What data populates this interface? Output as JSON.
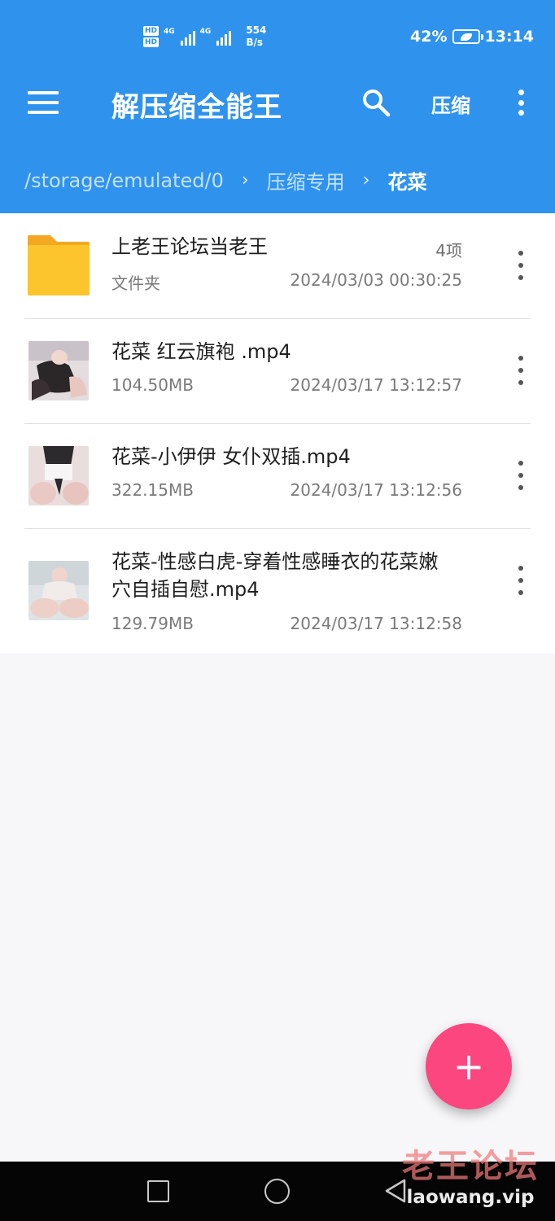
{
  "status_bar": {
    "hd1": "HD",
    "hd2": "HD",
    "net1": "4G",
    "net2": "4G",
    "speed_value": "554",
    "speed_unit": "B/s",
    "battery": "42%",
    "time": "13:14"
  },
  "app_bar": {
    "title": "解压缩全能王",
    "compress_label": "压缩"
  },
  "breadcrumb": {
    "items": [
      "/storage/emulated/0",
      "压缩专用",
      "花菜"
    ],
    "separator": "›"
  },
  "files": [
    {
      "type": "folder",
      "name": "上老王论坛当老王",
      "sub": "文件夹",
      "count": "4项",
      "date": "2024/03/03 00:30:25"
    },
    {
      "type": "video",
      "name": "花菜  红云旗袍 .mp4",
      "sub": "104.50MB",
      "date": "2024/03/17 13:12:57"
    },
    {
      "type": "video",
      "name": "花菜-小伊伊  女仆双插.mp4",
      "sub": "322.15MB",
      "date": "2024/03/17 13:12:56"
    },
    {
      "type": "video",
      "name": "花菜-性感白虎-穿着性感睡衣的花菜嫩穴自插自慰.mp4",
      "sub": "129.79MB",
      "date": "2024/03/17 13:12:58"
    }
  ],
  "fab": {
    "label": "+"
  },
  "watermark": {
    "cn": "老王论坛",
    "en": "laowang.vip"
  },
  "colors": {
    "primary": "#2f93ee",
    "fab": "#fc4680",
    "folder": "#fcc52d"
  },
  "icons": [
    "menu-icon",
    "search-icon",
    "more-vert-icon",
    "folder-icon",
    "video-thumbnail",
    "plus-icon",
    "nav-recents-icon",
    "nav-home-icon",
    "nav-back-icon"
  ]
}
